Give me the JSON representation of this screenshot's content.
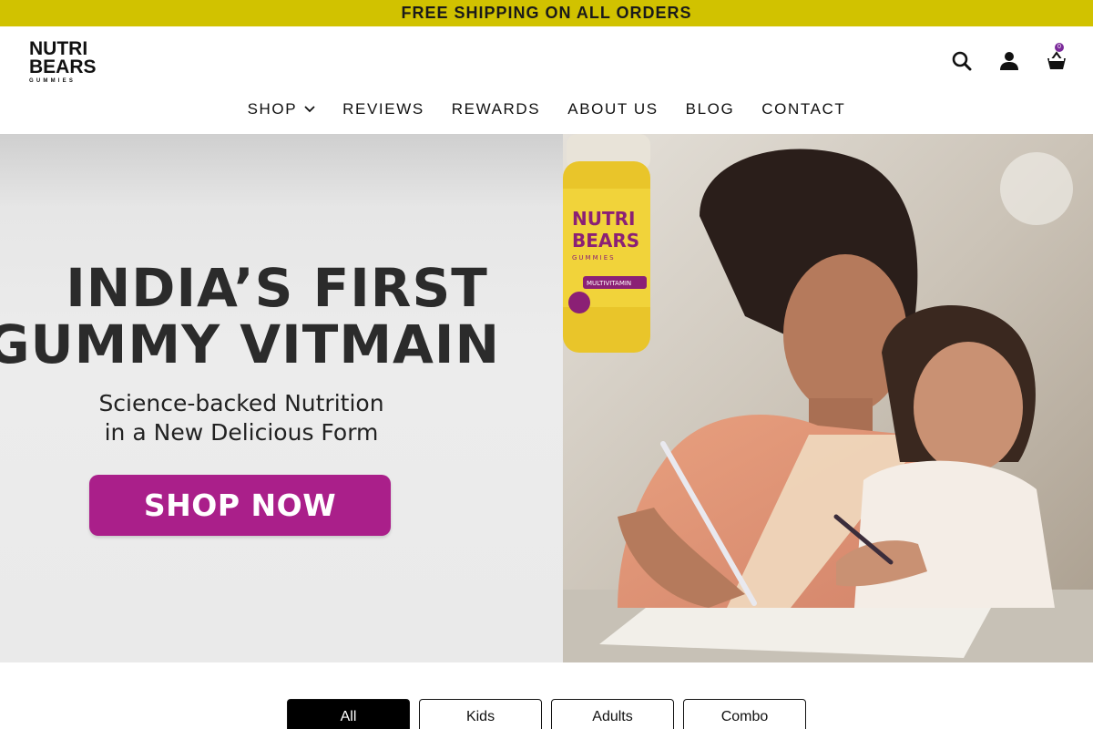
{
  "announcement": {
    "text": "FREE SHIPPING ON ALL ORDERS"
  },
  "brand": {
    "logo_line1": "NUTRI",
    "logo_line2": "BEARS",
    "logo_line3": "GUMMIES"
  },
  "header": {
    "icons": [
      "search-icon",
      "account-icon",
      "cart-icon"
    ],
    "cart_count": "0"
  },
  "nav": {
    "items": [
      {
        "label": "SHOP",
        "has_dropdown": true
      },
      {
        "label": "REVIEWS"
      },
      {
        "label": "REWARDS"
      },
      {
        "label": "ABOUT US"
      },
      {
        "label": "BLOG"
      },
      {
        "label": "CONTACT"
      }
    ]
  },
  "hero": {
    "title_line1": "INDIA’S FIRST",
    "title_line2": "GUMMY VITMAIN",
    "subtitle_line1": "Science-backed Nutrition",
    "subtitle_line2": "in a New Delicious Form",
    "cta_label": "SHOP NOW",
    "jar_text_line1": "NUTRI",
    "jar_text_line2": "BEARS",
    "jar_text_line3": "GUMMIES",
    "jar_badge": "MULTIVITAMIN"
  },
  "colors": {
    "announcement_bg": "#d1c200",
    "cta_bg": "#aa1f8a",
    "active_tab_bg": "#000000"
  },
  "tabs": {
    "items": [
      {
        "label": "All",
        "active": true
      },
      {
        "label": "Kids",
        "active": false
      },
      {
        "label": "Adults",
        "active": false
      },
      {
        "label": "Combo",
        "active": false
      }
    ]
  }
}
